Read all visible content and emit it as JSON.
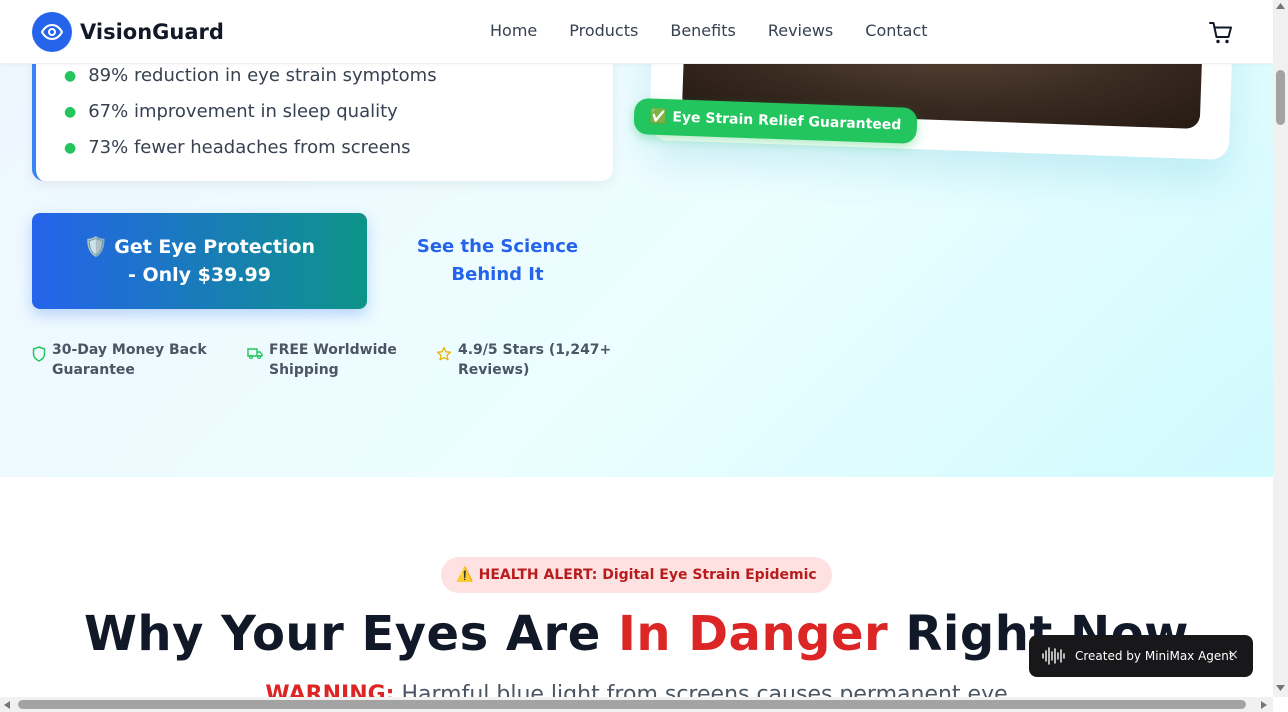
{
  "brand": {
    "name": "VisionGuard"
  },
  "nav": {
    "items": [
      "Home",
      "Products",
      "Benefits",
      "Reviews",
      "Contact"
    ]
  },
  "hero": {
    "stats": [
      "89% reduction in eye strain symptoms",
      "67% improvement in sleep quality",
      "73% fewer headaches from screens"
    ],
    "cta_primary_line1": "🛡️ Get Eye Protection",
    "cta_primary_line2": "- Only $39.99",
    "cta_secondary_line1": "See the Science",
    "cta_secondary_line2": "Behind It",
    "trust": [
      {
        "line1": "30-Day Money Back",
        "line2": "Guarantee",
        "icon": "shield-icon"
      },
      {
        "line1": "FREE Worldwide",
        "line2": "Shipping",
        "icon": "truck-icon"
      },
      {
        "line1": "4.9/5 Stars (1,247+",
        "line2": "Reviews)",
        "icon": "star-icon"
      }
    ],
    "image_badge": "✅ Eye Strain Relief Guaranteed"
  },
  "danger": {
    "alert": "⚠️ HEALTH ALERT: Digital Eye Strain Epidemic",
    "heading_pre": "Why Your Eyes Are ",
    "heading_red": "In Danger",
    "heading_post": " Right Now",
    "warning_label": "WARNING:",
    "warning_text": " Harmful blue light from screens causes permanent eye"
  },
  "toast": {
    "text": "Created by MiniMax Agent",
    "close": "×"
  },
  "colors": {
    "primary": "#2563eb",
    "teal": "#0d9488",
    "success": "#22c55e",
    "danger": "#dc2626"
  }
}
